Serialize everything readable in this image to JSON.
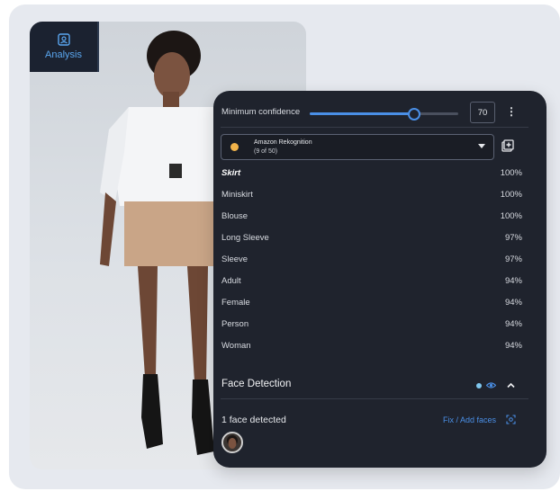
{
  "analysis": {
    "label": "Analysis",
    "icon": "analysis-icon"
  },
  "confidence": {
    "label": "Minimum confidence",
    "value": "70",
    "fraction": 0.7
  },
  "provider": {
    "name": "Amazon Rekognition",
    "sub": "(9 of 50)",
    "dot_color": "#f1b34a"
  },
  "labels": [
    {
      "name": "Skirt",
      "value": "100%"
    },
    {
      "name": "Miniskirt",
      "value": "100%"
    },
    {
      "name": "Blouse",
      "value": "100%"
    },
    {
      "name": "Long Sleeve",
      "value": "97%"
    },
    {
      "name": "Sleeve",
      "value": "97%"
    },
    {
      "name": "Adult",
      "value": "94%"
    },
    {
      "name": "Female",
      "value": "94%"
    },
    {
      "name": "Person",
      "value": "94%"
    },
    {
      "name": "Woman",
      "value": "94%"
    }
  ],
  "face": {
    "title": "Face Detection",
    "count_text": "1 face detected",
    "fix_label": "Fix / Add faces"
  },
  "colors": {
    "accent": "#4a8fe6",
    "panel": "#1f232d",
    "provider_dot": "#f1b34a"
  }
}
